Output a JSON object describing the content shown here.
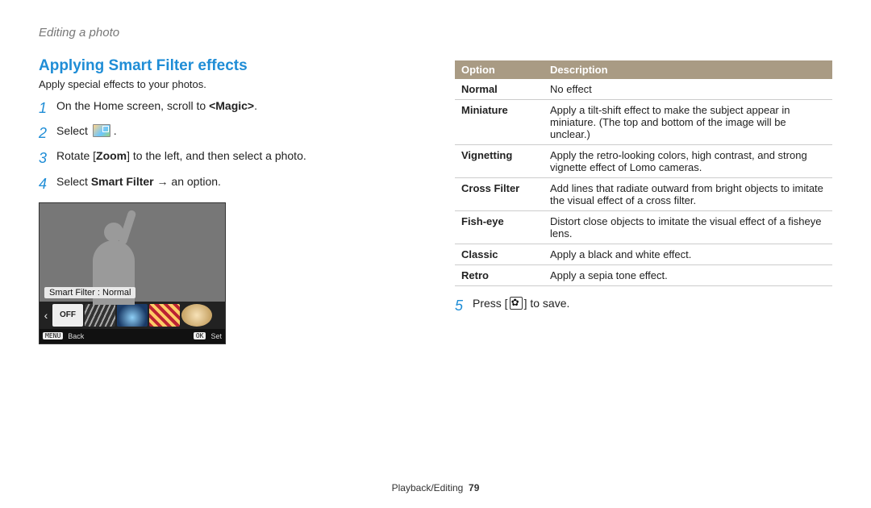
{
  "page_topic": "Editing a photo",
  "section_heading": "Applying Smart Filter effects",
  "section_sub": "Apply special effects to your photos.",
  "steps_left": [
    {
      "num": "1",
      "html": "On the Home screen, scroll to <b>&lt;Magic&gt;</b>."
    },
    {
      "num": "2",
      "html": "Select "
    },
    {
      "num": "3",
      "html": "Rotate [<b>Zoom</b>] to the left, and then select a photo."
    },
    {
      "num": "4",
      "html": "Select <b>Smart Filter</b> → an option."
    }
  ],
  "preview": {
    "label": "Smart Filter : Normal",
    "off_label": "OFF",
    "menu_btn": "MENU",
    "menu_text": "Back",
    "ok_btn": "OK",
    "ok_text": "Set"
  },
  "table": {
    "headers": {
      "option": "Option",
      "description": "Description"
    },
    "rows": [
      {
        "option": "Normal",
        "desc": "No effect"
      },
      {
        "option": "Miniature",
        "desc": "Apply a tilt-shift effect to make the subject appear in miniature. (The top and bottom of the image will be unclear.)"
      },
      {
        "option": "Vignetting",
        "desc": "Apply the retro-looking colors, high contrast, and strong vignette effect of Lomo cameras."
      },
      {
        "option": "Cross Filter",
        "desc": "Add lines that radiate outward from bright objects to imitate the visual effect of a cross filter."
      },
      {
        "option": "Fish-eye",
        "desc": "Distort close objects to imitate the visual effect of a fisheye lens."
      },
      {
        "option": "Classic",
        "desc": "Apply a black and white effect."
      },
      {
        "option": "Retro",
        "desc": "Apply a sepia tone effect."
      }
    ]
  },
  "step_right": {
    "num": "5",
    "before": "Press [",
    "after": "] to save."
  },
  "footer": {
    "section": "Playback/Editing",
    "page": "79"
  }
}
